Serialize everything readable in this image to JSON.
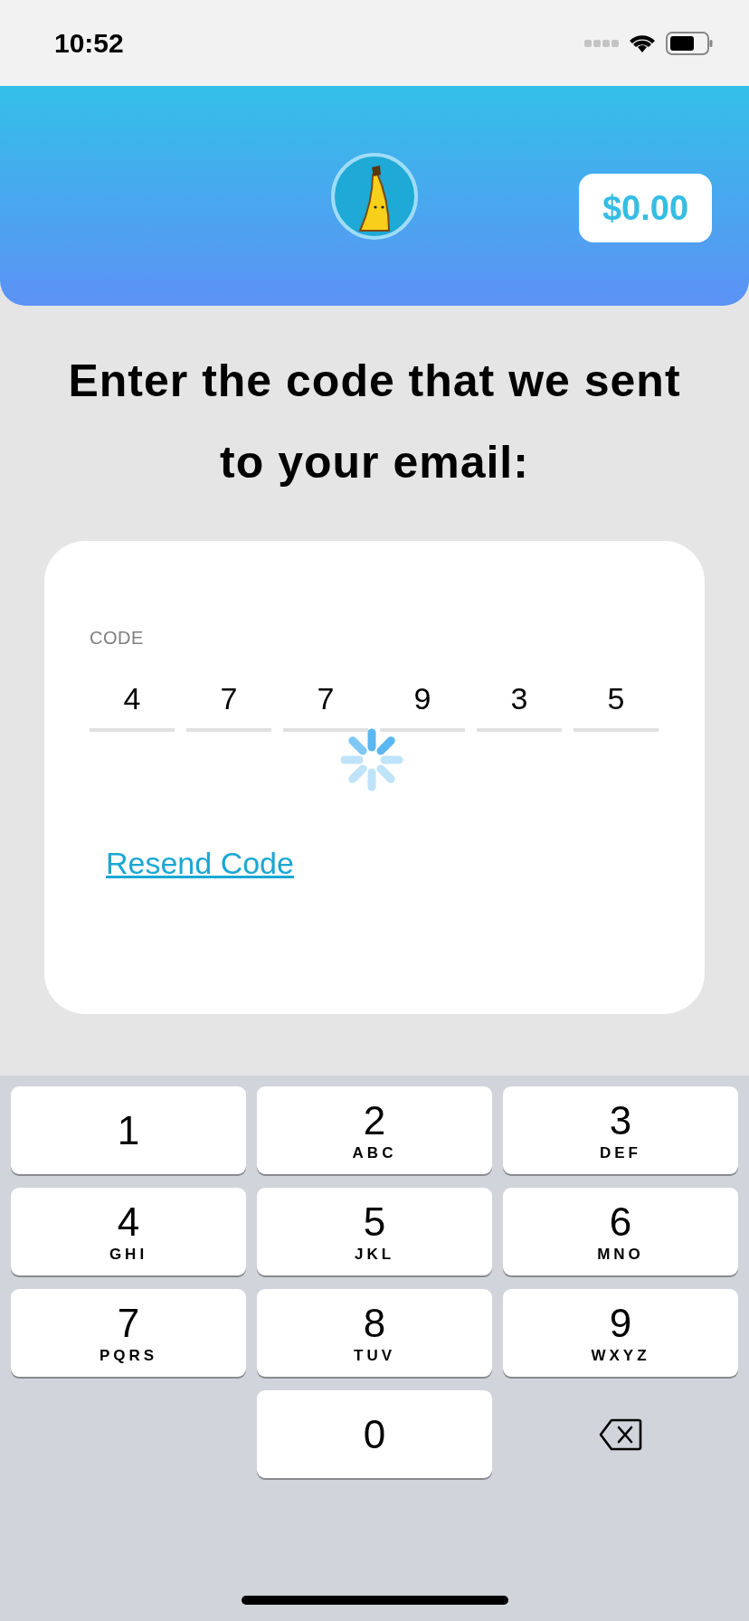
{
  "status_bar": {
    "time": "10:52"
  },
  "header": {
    "balance": "$0.00"
  },
  "title": "Enter the code that we sent to your email:",
  "code_card": {
    "label": "CODE",
    "digits": [
      {
        "value": "4"
      },
      {
        "value": "7"
      },
      {
        "value": "7"
      },
      {
        "value": "9"
      },
      {
        "value": "3"
      },
      {
        "value": "5"
      }
    ],
    "loading": true,
    "resend_link": "Resend Code"
  },
  "keypad": [
    {
      "kind": "digit",
      "digit": "1"
    },
    {
      "kind": "digit",
      "digit": "2",
      "letters": "ABC"
    },
    {
      "kind": "digit",
      "digit": "3",
      "letters": "DEF"
    },
    {
      "kind": "digit",
      "digit": "4",
      "letters": "GHI"
    },
    {
      "kind": "digit",
      "digit": "5",
      "letters": "JKL"
    },
    {
      "kind": "digit",
      "digit": "6",
      "letters": "MNO"
    },
    {
      "kind": "digit",
      "digit": "7",
      "letters": "PQRS"
    },
    {
      "kind": "digit",
      "digit": "8",
      "letters": "TUV"
    },
    {
      "kind": "digit",
      "digit": "9",
      "letters": "WXYZ"
    },
    {
      "kind": "blank"
    },
    {
      "kind": "digit",
      "digit": "0"
    },
    {
      "kind": "delete"
    }
  ]
}
